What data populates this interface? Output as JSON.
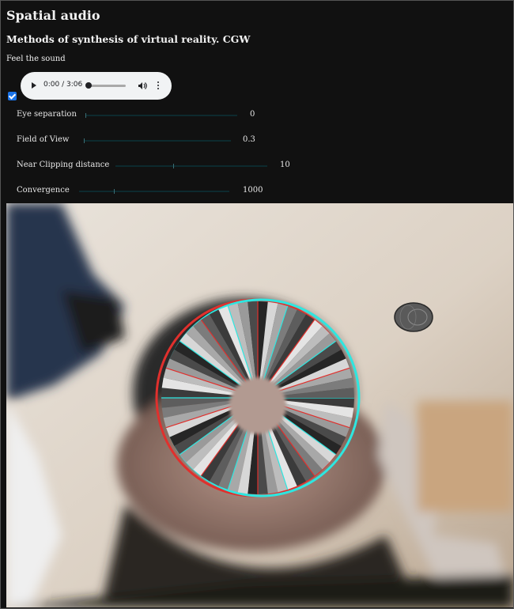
{
  "page": {
    "title": "Spatial audio",
    "subtitle": "Methods of synthesis of virtual reality. CGW",
    "caption": "Feel the sound"
  },
  "audio_player": {
    "time": "0:00 / 3:06",
    "progress": 0,
    "icons": [
      "play-icon",
      "volume-icon",
      "more-icon"
    ]
  },
  "controls": [
    {
      "label": "Eye separation",
      "value": "0",
      "level": 0.0
    },
    {
      "label": "Field of View",
      "value": "0.3",
      "level": 0.0
    },
    {
      "label": "Near Clipping distance",
      "value": "10",
      "level": 0.5
    },
    {
      "label": "Convergence",
      "value": "1000",
      "level": 0.22
    }
  ],
  "colors": {
    "background": "#111111",
    "checkbox": "#1a73e8",
    "anaglyph_red": "#e0302d",
    "anaglyph_cyan": "#2ee6e0"
  }
}
